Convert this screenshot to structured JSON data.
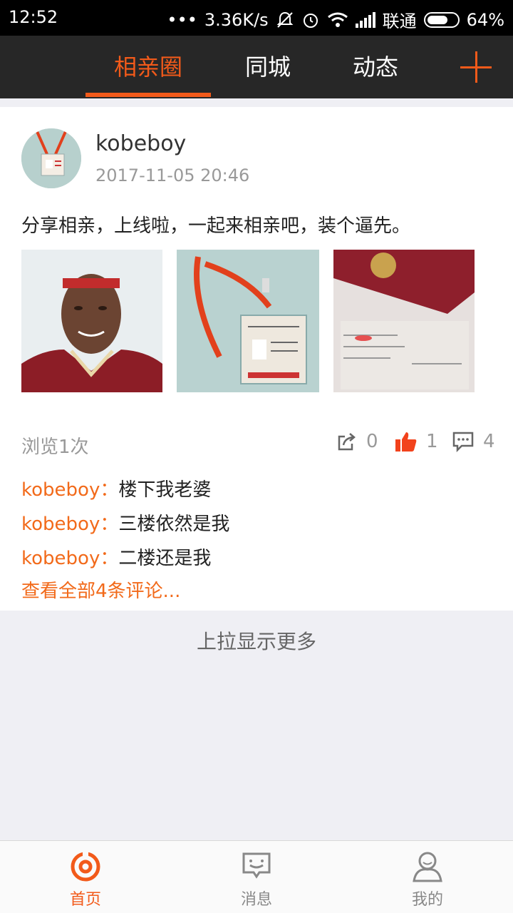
{
  "status_bar": {
    "time": "12:52",
    "dots": "•••",
    "speed": "3.36K/s",
    "carrier": "联通",
    "battery": "64%"
  },
  "top_nav": {
    "tabs": [
      "相亲圈",
      "同城",
      "动态"
    ],
    "active_index": 0,
    "accent_color": "#f25a1a"
  },
  "post": {
    "username": "kobeboy",
    "time": "2017-11-05 20:46",
    "text": "分享相亲，上线啦，一起来相亲吧，装个逼先。",
    "views": "浏览1次",
    "share_count": "0",
    "like_count": "1",
    "comment_count": "4",
    "comments": [
      {
        "user": "kobeboy",
        "sep": "：",
        "text": "楼下我老婆"
      },
      {
        "user": "kobeboy",
        "sep": "：",
        "text": "三楼依然是我"
      },
      {
        "user": "kobeboy",
        "sep": "：",
        "text": "二楼还是我"
      }
    ],
    "view_all": "查看全部4条评论..."
  },
  "load_more": "上拉显示更多",
  "tab_bar": {
    "items": [
      "首页",
      "消息",
      "我的"
    ],
    "active_index": 0
  }
}
